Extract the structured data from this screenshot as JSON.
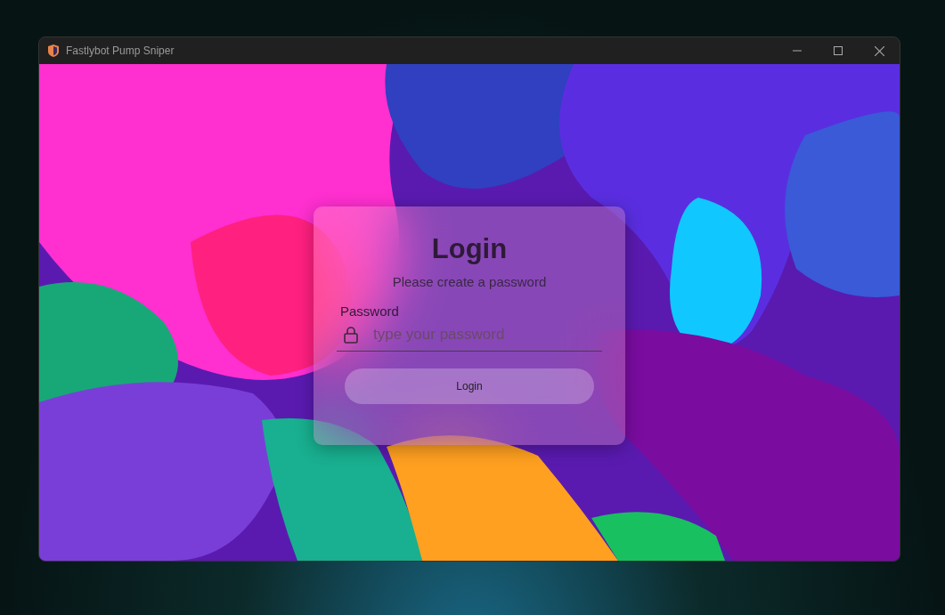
{
  "window": {
    "title": "Fastlybot Pump Sniper"
  },
  "login": {
    "title": "Login",
    "subtitle": "Please create a password",
    "field_label": "Password",
    "password": {
      "placeholder": "type your password"
    },
    "button": "Login"
  }
}
